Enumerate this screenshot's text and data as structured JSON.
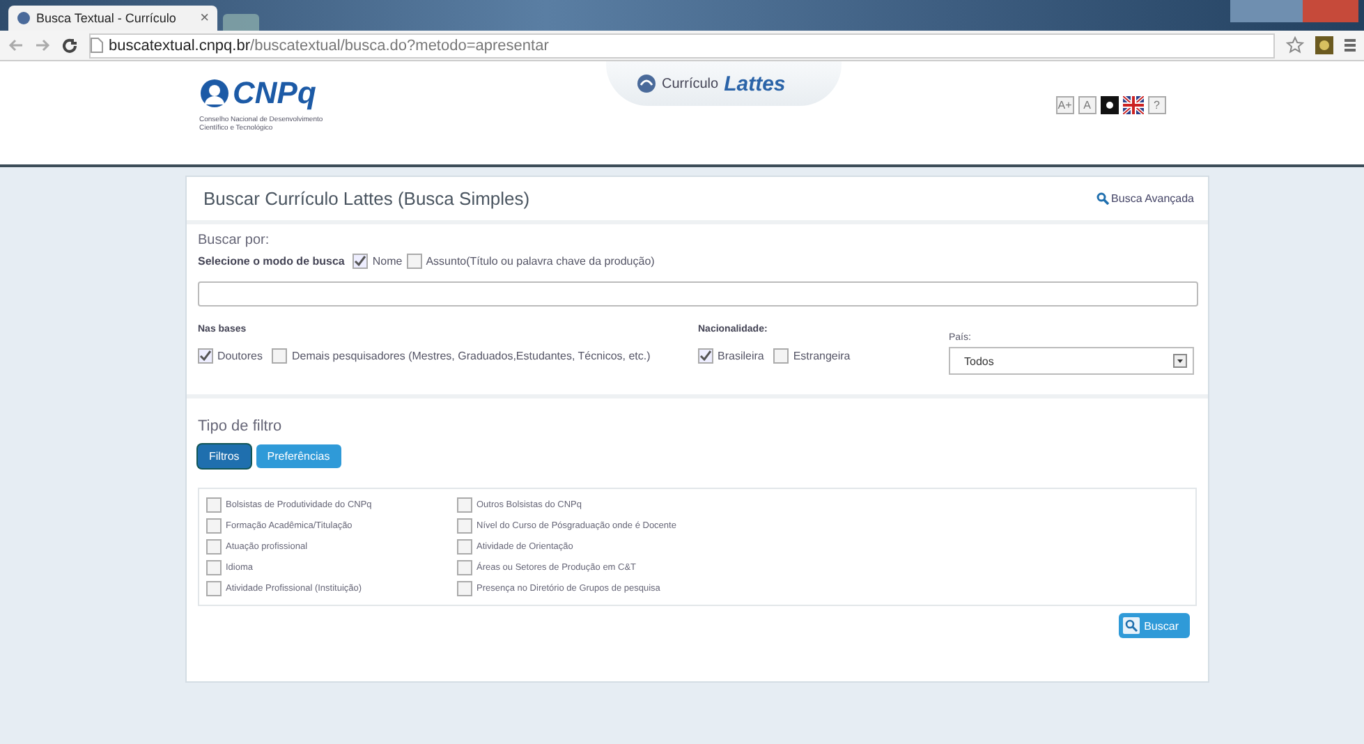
{
  "browser": {
    "tab_title": "Busca Textual - Currículo",
    "tab_close": "×",
    "url_host": "buscatextual.cnpq.br",
    "url_path": "/buscatextual/busca.do?metodo=apresentar"
  },
  "header": {
    "logo_text": "CNPq",
    "logo_subtitle": "Conselho Nacional de Desenvolvimento Científico e Tecnológico",
    "center_prefix": "Currículo",
    "center_title": "Lattes",
    "tools": [
      {
        "kind": "text",
        "label": "A+"
      },
      {
        "kind": "text",
        "label": "A"
      },
      {
        "kind": "contrast"
      },
      {
        "kind": "flag"
      },
      {
        "kind": "text",
        "label": "?"
      }
    ]
  },
  "card": {
    "title": "Buscar Currículo Lattes (Busca Simples)",
    "advanced_link": "Busca Avançada",
    "search_by": "Buscar por:",
    "mode_label": "Selecione o modo de busca",
    "modes": [
      {
        "label": "Nome",
        "checked": true
      },
      {
        "label": "Assunto(Título ou palavra chave da produção)",
        "checked": false
      }
    ],
    "bases": {
      "label": "Nas bases",
      "options": [
        {
          "label": "Doutores",
          "checked": true
        },
        {
          "label": "Demais pesquisadores (Mestres, Graduados,Estudantes, Técnicos, etc.)",
          "checked": false
        }
      ]
    },
    "nationality": {
      "label": "Nacionalidade:",
      "options": [
        {
          "label": "Brasileira",
          "checked": true
        },
        {
          "label": "Estrangeira",
          "checked": false
        }
      ]
    },
    "country": {
      "label": "País:",
      "value": "Todos"
    },
    "filter_type": {
      "label": "Tipo de filtro",
      "tabs": [
        {
          "label": "Filtros",
          "selected": true
        },
        {
          "label": "Preferências",
          "selected": false
        }
      ]
    },
    "filters": [
      {
        "label": "Bolsistas de Produtividade do CNPq",
        "checked": false
      },
      {
        "label": "Formação Acadêmica/Titulação",
        "checked": false
      },
      {
        "label": "Atuação profissional",
        "checked": false
      },
      {
        "label": "Idioma",
        "checked": false
      },
      {
        "label": "Atividade Profissional (Instituição)",
        "checked": false
      },
      {
        "label": "Outros Bolsistas do CNPq",
        "checked": false
      },
      {
        "label": "Nível do Curso de Pósgraduação onde é Docente",
        "checked": false
      },
      {
        "label": "Atividade de Orientação",
        "checked": false
      },
      {
        "label": "Áreas ou Setores de Produção em C&T",
        "checked": false
      },
      {
        "label": "Presença no Diretório de Grupos de pesquisa",
        "checked": false
      }
    ],
    "submit": "Buscar"
  }
}
